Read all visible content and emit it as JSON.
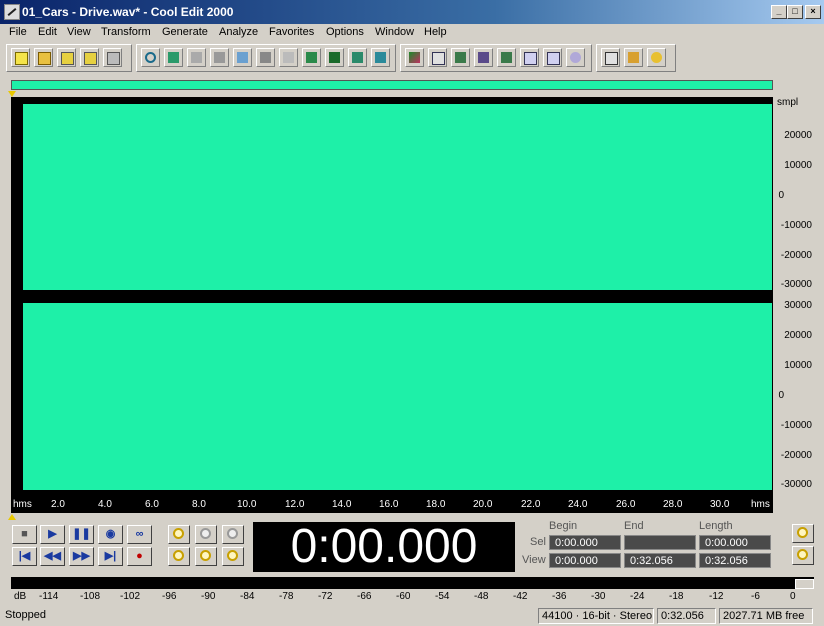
{
  "window": {
    "title": "01_Cars - Drive.wav* - Cool Edit 2000",
    "minimize": "_",
    "maximize": "□",
    "close": "×"
  },
  "menu": [
    "File",
    "Edit",
    "View",
    "Transform",
    "Generate",
    "Analyze",
    "Favorites",
    "Options",
    "Window",
    "Help"
  ],
  "waveform": {
    "color": "#1ef0a8",
    "units": "smpl",
    "top_scale": [
      "20000",
      "10000",
      "0",
      "-10000",
      "-20000",
      "-30000"
    ],
    "bottom_scale": [
      "30000",
      "20000",
      "10000",
      "0",
      "-10000",
      "-20000",
      "-30000"
    ]
  },
  "timeline": {
    "unit": "hms",
    "labels": [
      "2.0",
      "4.0",
      "6.0",
      "8.0",
      "10.0",
      "12.0",
      "14.0",
      "16.0",
      "18.0",
      "20.0",
      "22.0",
      "24.0",
      "26.0",
      "28.0",
      "30.0"
    ]
  },
  "transport": {
    "time": "0:00.000"
  },
  "selection": {
    "headers": {
      "begin": "Begin",
      "end": "End",
      "length": "Length"
    },
    "sel": {
      "label": "Sel",
      "begin": "0:00.000",
      "end": "",
      "length": "0:00.000"
    },
    "view": {
      "label": "View",
      "begin": "0:00.000",
      "end": "0:32.056",
      "length": "0:32.056"
    }
  },
  "meter": {
    "labels": [
      "dB",
      "-114",
      "-108",
      "-102",
      "-96",
      "-90",
      "-84",
      "-78",
      "-72",
      "-66",
      "-60",
      "-54",
      "-48",
      "-42",
      "-36",
      "-30",
      "-24",
      "-18",
      "-12",
      "-6",
      "0"
    ]
  },
  "status": {
    "state": "Stopped",
    "format": "44100 · 16-bit · Stereo",
    "duration": "0:32.056",
    "free": "2027.71 MB free"
  }
}
